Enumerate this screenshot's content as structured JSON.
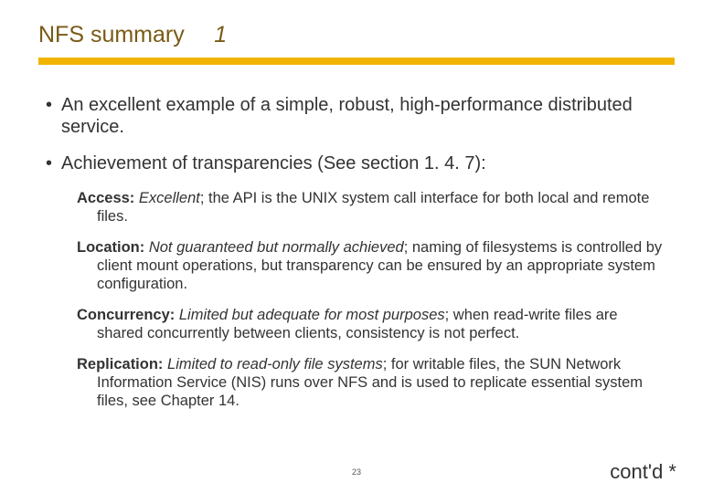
{
  "title": {
    "text": "NFS summary",
    "number": "1"
  },
  "bullets": [
    {
      "text": "An excellent example of a simple, robust, high-performance distributed service."
    },
    {
      "text": "Achievement of transparencies (See section 1. 4. 7):"
    }
  ],
  "sub_items": [
    {
      "lead": "Access:",
      "annot": " Excellent",
      "rest": "; the API is the UNIX system call interface for both local and remote files."
    },
    {
      "lead": "Location:",
      "annot": " Not guaranteed but normally achieved",
      "rest": "; naming of filesystems is controlled by client mount operations, but transparency can be ensured by an appropriate system configuration."
    },
    {
      "lead": "Concurrency:",
      "annot": " Limited but adequate for most purposes",
      "rest": "; when read-write files are shared concurrently between clients, consistency is not perfect."
    },
    {
      "lead": "Replication:",
      "annot": " Limited to read-only file systems",
      "rest": "; for writable files, the SUN Network Information Service (NIS) runs over NFS and is used to replicate essential system files, see Chapter 14."
    }
  ],
  "page_number": "23",
  "contd": "cont'd",
  "contd_mark": " *"
}
